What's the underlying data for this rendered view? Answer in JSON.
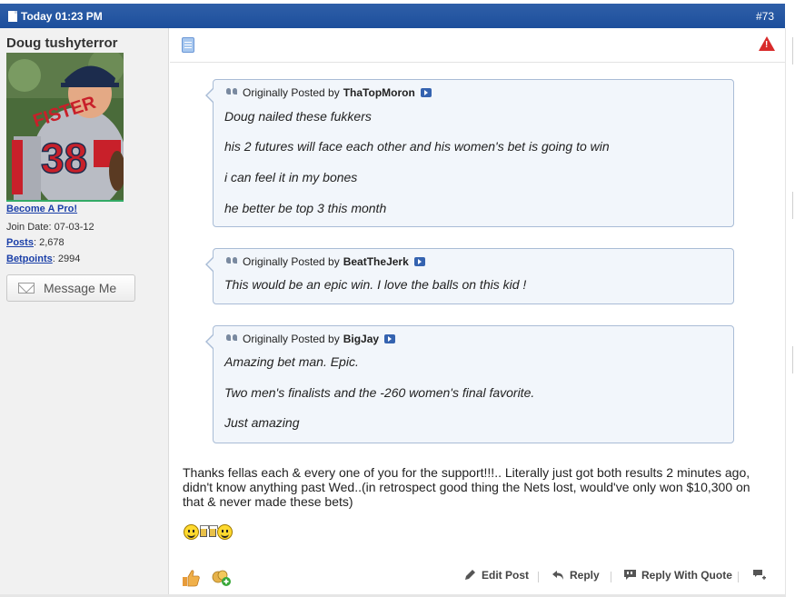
{
  "header": {
    "date": "Today 01:23 PM",
    "post_number": "#73"
  },
  "user": {
    "username": "Doug tushyterror",
    "promo_link": "Become A Pro!",
    "join_date": "Join Date: 07-03-12",
    "posts_label": "Posts",
    "posts_value": ": 2,678",
    "betpoints_label": "Betpoints",
    "betpoints_value": ": 2994",
    "message_button": "Message Me"
  },
  "quotes": [
    {
      "prefix": "Originally Posted by",
      "author": "ThaTopMoron",
      "lines": [
        "Doug nailed these fukkers",
        "his 2 futures will face each other and his women's bet is going to win",
        "i can feel it in my bones",
        "he better be top 3 this month"
      ]
    },
    {
      "prefix": "Originally Posted by",
      "author": "BeatTheJerk",
      "lines": [
        "This would be an epic win. I love the balls on this kid !"
      ]
    },
    {
      "prefix": "Originally Posted by",
      "author": "BigJay",
      "lines": [
        "Amazing bet man. Epic.",
        "Two men's finalists and the -260 women's final favorite.",
        "Just amazing"
      ]
    }
  ],
  "message": {
    "text": "Thanks fellas each & every one of you for the support!!!.. Literally just got both results 2 minutes ago, didn't know anything past Wed..(in retrospect good thing the Nets lost, would've only won $10,300 on that & never made these bets)"
  },
  "footer": {
    "edit_post": "Edit Post",
    "reply": "Reply",
    "reply_with_quote": "Reply With Quote"
  },
  "colors": {
    "header_blue": "#1d4f9c",
    "link_blue": "#1a3fa8",
    "report_red": "#d82b2b"
  },
  "icons": [
    "doc-icon",
    "report-icon",
    "quote-icon",
    "view-post-icon",
    "thumbs-up-icon",
    "add-group-icon",
    "edit-icon",
    "reply-icon",
    "quote-reply-icon",
    "multi-quote-icon"
  ]
}
